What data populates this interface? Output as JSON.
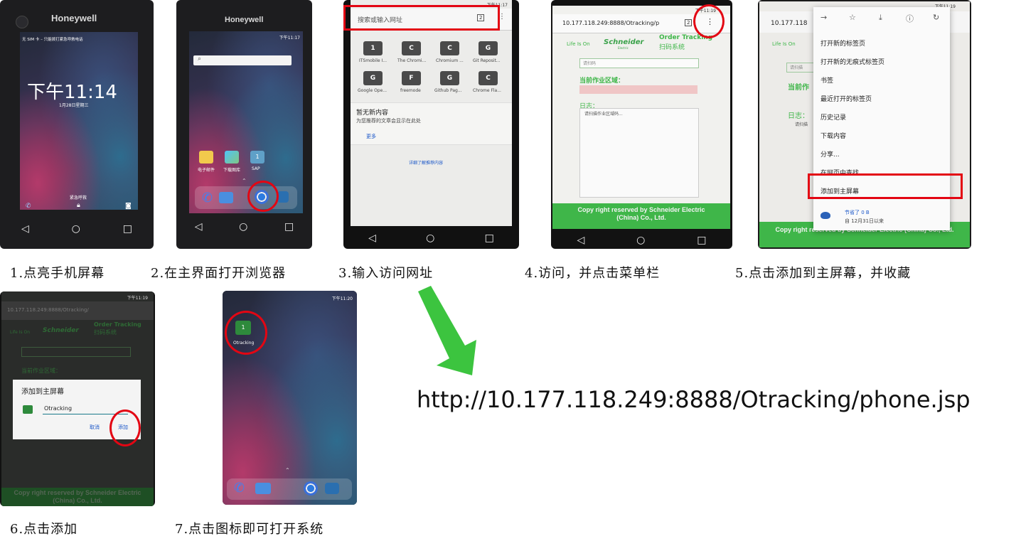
{
  "captions": {
    "step1": "1.点亮手机屏幕",
    "step2": "2.在主界面打开浏览器",
    "step3": "3.输入访问网址",
    "step4": "4.访问，并点击菜单栏",
    "step5": "5.点击添加到主屏幕，并收藏",
    "step6": "6.点击添加",
    "step7": "7.点击图标即可打开系统"
  },
  "url": "http://10.177.118.249:8888/Otracking/phone.jsp",
  "colors": {
    "highlight": "#e30613",
    "arrow": "#3cc43f",
    "footer_green": "#3fb649"
  },
  "shot1": {
    "brand": "Honeywell",
    "status_left": "无 SIM 卡 – 只能拨打紧急呼救电话",
    "time": "下午11:14",
    "date": "1月28日星期三",
    "emergency": "紧急呼救"
  },
  "shot2": {
    "brand": "Honeywell",
    "status_time": "下午11:17",
    "apps": [
      "电子邮件",
      "下载图库",
      "SAP"
    ],
    "app_tile_letter": "1"
  },
  "shot3": {
    "status_time": "下午11:17",
    "address_placeholder": "搜索或输入网址",
    "tab_count": "2",
    "tiles": [
      {
        "letter": "1",
        "label": "ITSmobile I..."
      },
      {
        "letter": "C",
        "label": "The Chromi..."
      },
      {
        "letter": "C",
        "label": "Chromium ..."
      },
      {
        "letter": "G",
        "label": "Git Reposit..."
      },
      {
        "letter": "G",
        "label": "Google Ope..."
      },
      {
        "letter": "F",
        "label": "freemode"
      },
      {
        "letter": "G",
        "label": "Github Pag..."
      },
      {
        "letter": "C",
        "label": "Chrome Fla..."
      }
    ],
    "no_content_title": "暂无新内容",
    "no_content_sub": "为您推荐的文章会显示在此处",
    "more": "更多",
    "learn_more": "详细了解推荐内容"
  },
  "shot4": {
    "status_time": "下午11:19",
    "address": "10.177.118.249:8888/Otracking/p",
    "tab_count": "2",
    "life_is_on": "Life Is On",
    "schneider": "Schneider",
    "schneider_sub": "Electric",
    "order_tracking": "Order Tracking",
    "scan_system": "扫码系统",
    "scan_placeholder": "请扫码",
    "area_label": "当前作业区域：",
    "log_label": "日志：",
    "log_text": "请扫描作业区域码...",
    "footer": "Copy right reserved by Schneider Electric (China) Co., Ltd."
  },
  "shot5": {
    "status_time": "下午11:19",
    "address": "10.177.118",
    "menu_items": [
      "打开新的标签页",
      "打开新的无痕式标签页",
      "书签",
      "最近打开的标签页",
      "历史记录",
      "下载内容",
      "分享...",
      "在网页中查找",
      "添加到主屏幕"
    ],
    "saved_line1": "节省了 0 B",
    "saved_line2": "自 12月31日以来",
    "bg_scan": "请扫描",
    "bg_area": "当前作",
    "bg_log": "日志：",
    "bg_log2": "请扫描",
    "bg_life": "Life Is On",
    "footer": "Copy right reserved by Schneider Electric (China) Co., Ltd."
  },
  "shot6": {
    "status_time": "下午11:19",
    "address": "10.177.118.249:8888/Otracking/",
    "dialog_title": "添加到主屏幕",
    "name_value": "Otracking",
    "cancel": "取消",
    "add": "添加",
    "bg_order": "Order Tracking",
    "bg_scan": "扫码系统",
    "bg_life": "Life Is On",
    "bg_schneider": "Schneider",
    "bg_area": "当前作业区域：",
    "footer": "Copy right reserved by Schneider Electric (China) Co., Ltd."
  },
  "shot7": {
    "status_time": "下午11:20",
    "app_tile_letter": "1",
    "app_label": "Otracking"
  }
}
